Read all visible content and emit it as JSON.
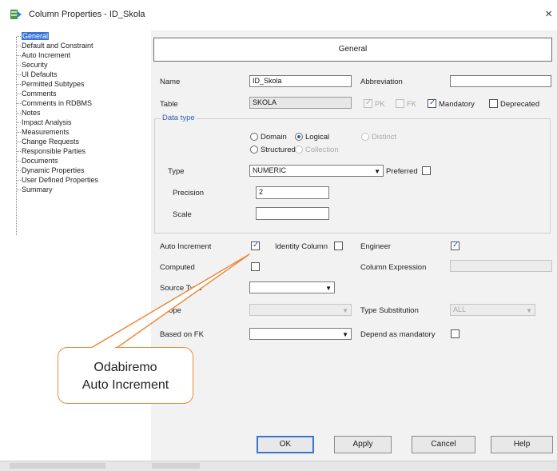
{
  "window": {
    "title": "Column Properties - ID_Skola",
    "close_glyph": "×"
  },
  "tree": {
    "items": [
      {
        "label": "General",
        "selected": true
      },
      {
        "label": "Default and Constraint"
      },
      {
        "label": "Auto Increment"
      },
      {
        "label": "Security"
      },
      {
        "label": "UI Defaults"
      },
      {
        "label": "Permitted Subtypes"
      },
      {
        "label": "Comments"
      },
      {
        "label": "Comments in RDBMS"
      },
      {
        "label": "Notes"
      },
      {
        "label": "Impact Analysis"
      },
      {
        "label": "Measurements"
      },
      {
        "label": "Change Requests"
      },
      {
        "label": "Responsible Parties"
      },
      {
        "label": "Documents"
      },
      {
        "label": "Dynamic Properties"
      },
      {
        "label": "User Defined Properties"
      },
      {
        "label": "Summary"
      }
    ]
  },
  "panel": {
    "header": "General",
    "name_label": "Name",
    "name_value": "ID_Skola",
    "abbreviation_label": "Abbreviation",
    "abbreviation_value": "",
    "table_label": "Table",
    "table_value": "SKOLA",
    "pk_label": "PK",
    "fk_label": "FK",
    "mandatory_label": "Mandatory",
    "deprecated_label": "Deprecated",
    "datatype": {
      "legend": "Data type",
      "domain_label": "Domain",
      "logical_label": "Logical",
      "distinct_label": "Distinct",
      "structured_label": "Structured",
      "collection_label": "Collection",
      "type_label": "Type",
      "type_value": "NUMERIC",
      "preferred_label": "Preferred",
      "precision_label": "Precision",
      "precision_value": "2",
      "scale_label": "Scale",
      "scale_value": ""
    },
    "auto_increment_label": "Auto Increment",
    "identity_column_label": "Identity Column",
    "engineer_label": "Engineer",
    "computed_label": "Computed",
    "column_expression_label": "Column Expression",
    "source_type_label": "Source Type",
    "scope_label": "Scope",
    "type_substitution_label": "Type Substitution",
    "type_substitution_value": "ALL",
    "based_on_fk_label": "Based on FK",
    "depend_as_mandatory_label": "Depend as mandatory"
  },
  "buttons": {
    "ok": "OK",
    "apply": "Apply",
    "cancel": "Cancel",
    "help": "Help"
  },
  "callout": {
    "line1": "Odabiremo",
    "line2": "Auto Increment",
    "border_color": "#ed8a3a"
  },
  "colors": {
    "selection": "#3875d7",
    "legend": "#2f5fb0",
    "callout_border": "#ed8a3a"
  }
}
